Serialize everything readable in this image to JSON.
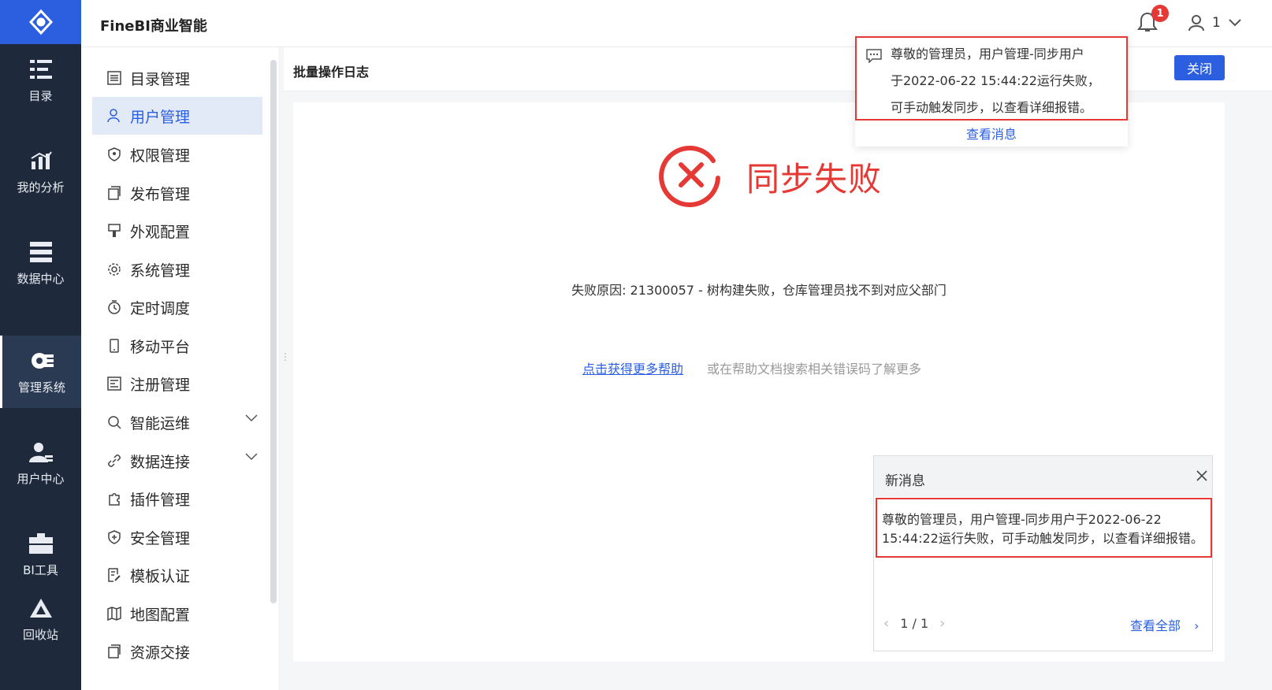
{
  "app": {
    "title": "FineBI商业智能"
  },
  "rail": {
    "items": [
      {
        "label": "目录",
        "icon": "catalog-icon"
      },
      {
        "label": "我的分析",
        "icon": "analysis-icon"
      },
      {
        "label": "数据中心",
        "icon": "data-center-icon"
      },
      {
        "label": "管理系统",
        "icon": "management-icon",
        "active": true
      },
      {
        "label": "用户中心",
        "icon": "user-center-icon"
      },
      {
        "label": "BI工具",
        "icon": "toolbox-icon"
      },
      {
        "label": "回收站",
        "icon": "recycle-bin-icon"
      }
    ]
  },
  "header": {
    "notification_count": "1",
    "user_name": "1"
  },
  "subnav": {
    "items": [
      {
        "label": "目录管理",
        "icon": "list-icon"
      },
      {
        "label": "用户管理",
        "icon": "user-icon",
        "active": true
      },
      {
        "label": "权限管理",
        "icon": "permission-icon"
      },
      {
        "label": "发布管理",
        "icon": "publish-icon"
      },
      {
        "label": "外观配置",
        "icon": "appearance-icon"
      },
      {
        "label": "系统管理",
        "icon": "settings-icon"
      },
      {
        "label": "定时调度",
        "icon": "timer-icon"
      },
      {
        "label": "移动平台",
        "icon": "mobile-icon"
      },
      {
        "label": "注册管理",
        "icon": "register-icon"
      },
      {
        "label": "智能运维",
        "icon": "ops-icon",
        "expandable": true
      },
      {
        "label": "数据连接",
        "icon": "link-icon",
        "expandable": true
      },
      {
        "label": "插件管理",
        "icon": "plugin-icon"
      },
      {
        "label": "安全管理",
        "icon": "security-icon"
      },
      {
        "label": "模板认证",
        "icon": "template-icon"
      },
      {
        "label": "地图配置",
        "icon": "map-icon"
      },
      {
        "label": "资源交接",
        "icon": "handover-icon"
      }
    ]
  },
  "main": {
    "title": "批量操作日志",
    "close_label": "关闭",
    "status_title": "同步失败",
    "fail_reason": "失败原因: 21300057 - 树构建失败，仓库管理员找不到对应父部门",
    "help_link": "点击获得更多帮助",
    "help_hint": "或在帮助文档搜索相关错误码了解更多"
  },
  "popover": {
    "lines": [
      "尊敬的管理员，用户管理-同步用户",
      "于2022-06-22 15:44:22运行失败，",
      "可手动触发同步，以查看详细报错。"
    ],
    "view_label": "查看消息"
  },
  "toast": {
    "title": "新消息",
    "message": "尊敬的管理员，用户管理-同步用户于2022-06-22 15:44:22运行失败，可手动触发同步，以查看详细报错。",
    "pager": "1 / 1",
    "view_all": "查看全部"
  },
  "colors": {
    "accent": "#2b5fe0",
    "error": "#e53935",
    "rail_bg": "#1e2a3b"
  }
}
